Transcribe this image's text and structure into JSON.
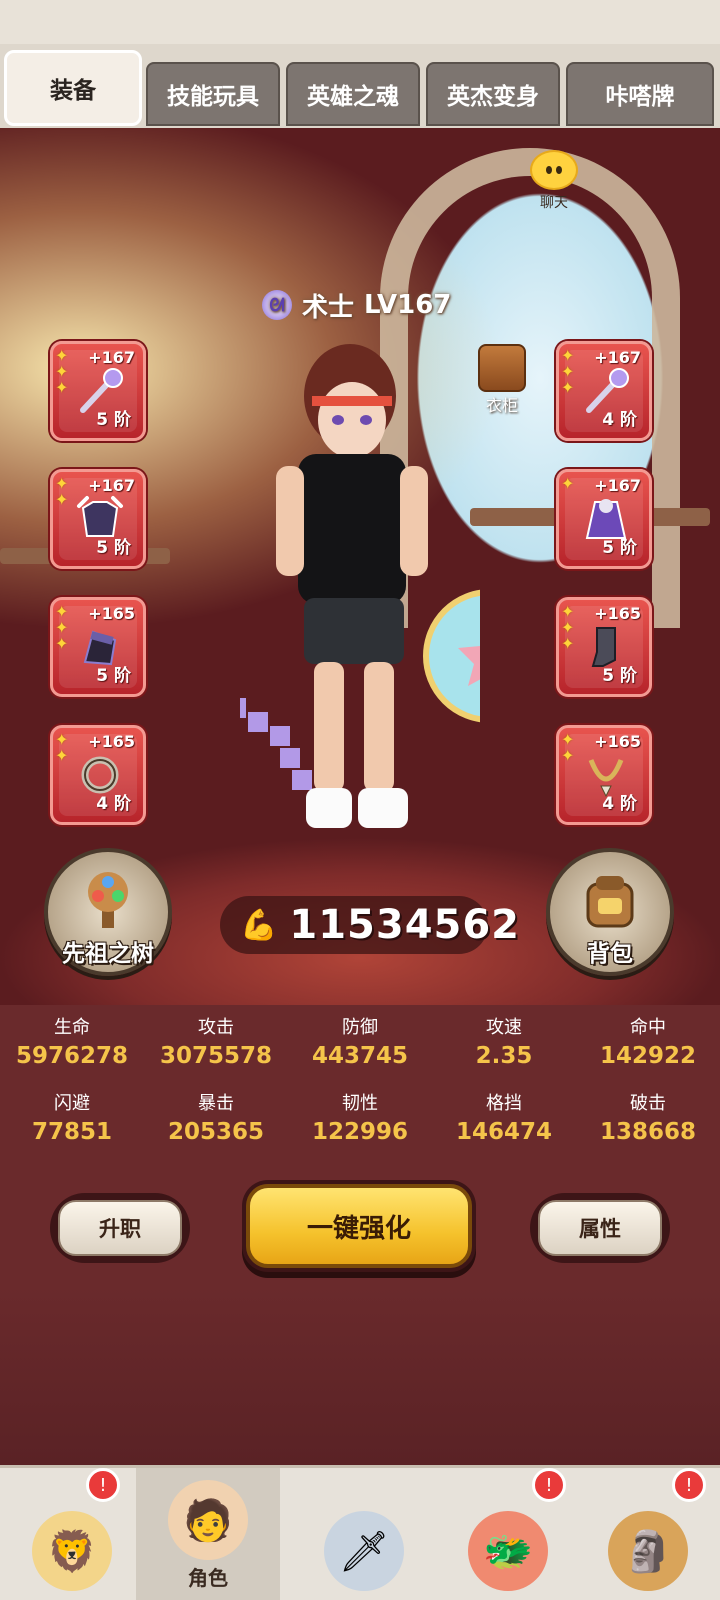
{
  "tabs": [
    "装备",
    "技能玩具",
    "英雄之魂",
    "英杰变身",
    "咔嗒牌"
  ],
  "chat_label": "聊天",
  "character": {
    "class_name": "术士",
    "level": "LV167"
  },
  "wardrobe_label": "衣柜",
  "slots_left": [
    {
      "plus": "+167",
      "tier": "5 阶",
      "icon": "staff-icon",
      "color": "#b49aef"
    },
    {
      "plus": "+167",
      "tier": "5 阶",
      "icon": "armor-icon",
      "color": "#3e3560"
    },
    {
      "plus": "+165",
      "tier": "5 阶",
      "icon": "helmet-icon",
      "color": "#6a5fa8"
    },
    {
      "plus": "+165",
      "tier": "4 阶",
      "icon": "ring-icon",
      "color": "#c9c0b0"
    }
  ],
  "slots_right": [
    {
      "plus": "+167",
      "tier": "4 阶",
      "icon": "staff-icon",
      "color": "#b49aef"
    },
    {
      "plus": "+167",
      "tier": "5 阶",
      "icon": "cloak-icon",
      "color": "#6c49b8"
    },
    {
      "plus": "+165",
      "tier": "5 阶",
      "icon": "boots-icon",
      "color": "#4b4b58"
    },
    {
      "plus": "+165",
      "tier": "4 阶",
      "icon": "necklace-icon",
      "color": "#d9b45a"
    }
  ],
  "ancestor_tree_label": "先祖之树",
  "backpack_label": "背包",
  "power": "11534562",
  "stats": [
    {
      "name": "生命",
      "value": "5976278"
    },
    {
      "name": "攻击",
      "value": "3075578"
    },
    {
      "name": "防御",
      "value": "443745"
    },
    {
      "name": "攻速",
      "value": "2.35"
    },
    {
      "name": "命中",
      "value": "142922"
    },
    {
      "name": "闪避",
      "value": "77851"
    },
    {
      "name": "暴击",
      "value": "205365"
    },
    {
      "name": "韧性",
      "value": "122996"
    },
    {
      "name": "格挡",
      "value": "146474"
    },
    {
      "name": "破击",
      "value": "138668"
    }
  ],
  "actions": {
    "promote": "升职",
    "auto_enhance": "一键强化",
    "attributes": "属性"
  },
  "nav": [
    {
      "label": "",
      "badge": "!"
    },
    {
      "label": "角色",
      "badge": ""
    },
    {
      "label": "",
      "badge": ""
    },
    {
      "label": "",
      "badge": "!"
    },
    {
      "label": "",
      "badge": "!"
    }
  ],
  "colors": {
    "accent_gold": "#f5c44a",
    "slot_red": "#c8323a",
    "panel": "#6a2a2c"
  }
}
